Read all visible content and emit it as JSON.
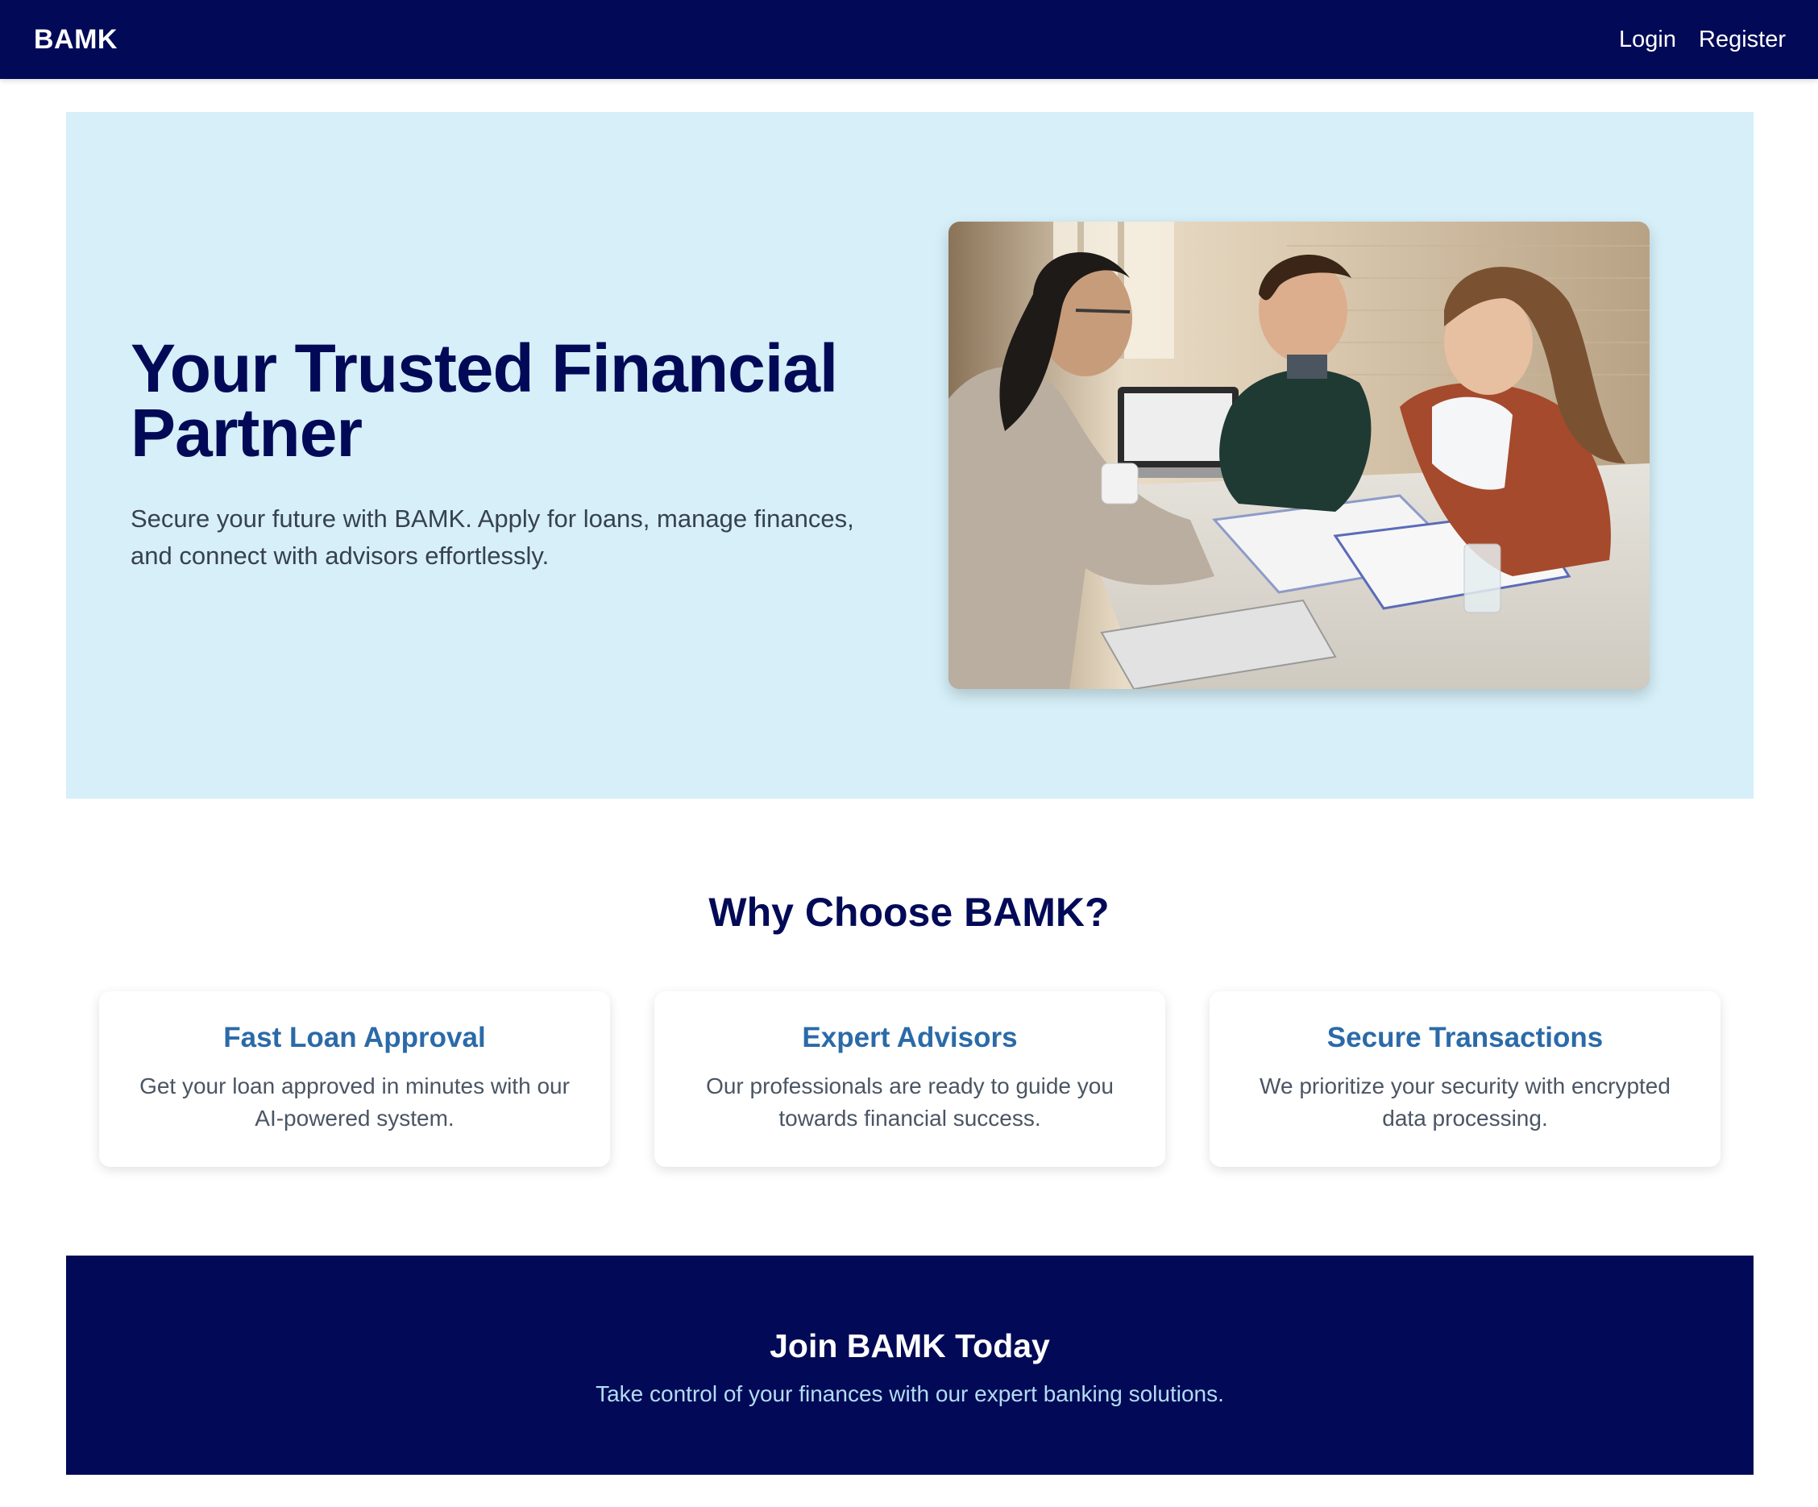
{
  "navbar": {
    "brand": "BAMK",
    "links": [
      {
        "label": "Login"
      },
      {
        "label": "Register"
      }
    ]
  },
  "hero": {
    "title": "Your Trusted Financial Partner",
    "subtitle": "Secure your future with BAMK. Apply for loans, manage finances, and connect with advisors effortlessly.",
    "image_description": "photo-advisor-meeting-couple"
  },
  "features": {
    "title": "Why Choose BAMK?",
    "cards": [
      {
        "title": "Fast Loan Approval",
        "text": "Get your loan approved in minutes with our AI-powered system."
      },
      {
        "title": "Expert Advisors",
        "text": "Our professionals are ready to guide you towards financial success."
      },
      {
        "title": "Secure Transactions",
        "text": "We prioritize your security with encrypted data processing."
      }
    ]
  },
  "cta": {
    "title": "Join BAMK Today",
    "subtitle": "Take control of your finances with our expert banking solutions."
  },
  "colors": {
    "navy": "#020a57",
    "hero_bg": "#d6eff8",
    "card_title_blue": "#2b6aa8",
    "cta_sub_blue": "#b3dcf2"
  }
}
